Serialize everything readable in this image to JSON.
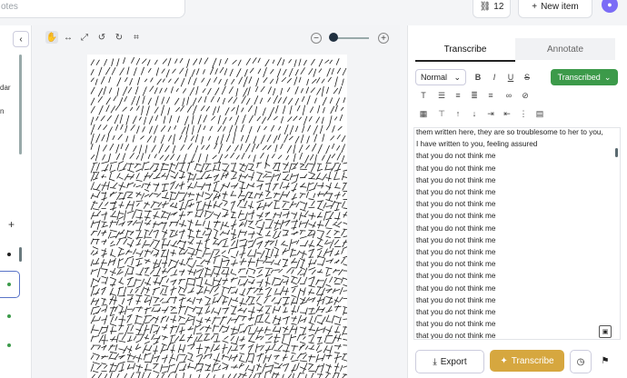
{
  "header": {
    "search_placeholder": "otes",
    "count": "12",
    "new_item": "New item",
    "avatar_initial": "",
    "accent": "#7b6cf6"
  },
  "left_panel": {
    "label_1": "dar",
    "label_2": "n",
    "add": "+",
    "collapse": "‹"
  },
  "viewer": {
    "tools": [
      "hand-icon",
      "fit-width-icon",
      "expand-icon",
      "rotate-left-icon",
      "rotate-right-icon",
      "crop-icon"
    ],
    "zoom_out": "−",
    "zoom_in": "+"
  },
  "right_panel": {
    "tabs": [
      "Transcribe",
      "Annotate"
    ],
    "style_select": "Normal",
    "status": "Transcribed",
    "status_color": "#3c9a4a",
    "transcript_lines": [
      "them written here, they are so troublesome to her to you,",
      "I have written to you, feeling assured",
      "that you do not think me",
      "that you do not think me",
      "that you do not think me",
      "that you do not think me",
      "that you do not think me",
      "that you do not think me",
      "that you do not think me",
      "that you do not think me",
      "that you do not think me",
      "that you do not think me",
      "that you do not think me",
      "that you do not think me",
      "that you do not think me",
      "that you do not think me",
      "that you do not think me",
      "that you do not think me"
    ],
    "export_label": "Export",
    "transcribe_label": "Transcribe",
    "transcribe_color": "#d6a73f"
  }
}
